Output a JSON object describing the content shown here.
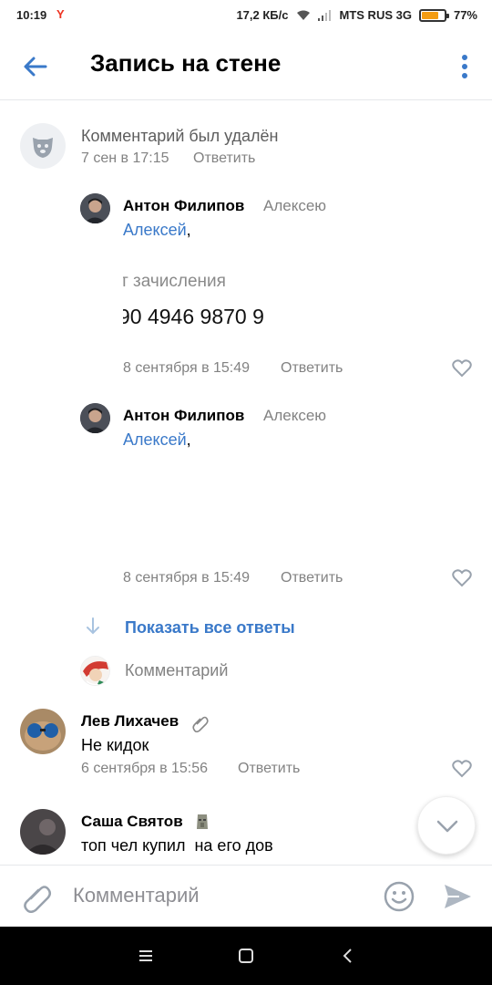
{
  "status_bar": {
    "time": "10:19",
    "app_icon": "Y",
    "network_speed": "17,2 КБ/с",
    "carrier": "MTS RUS 3G",
    "battery": "77%",
    "battery_level": 0.77
  },
  "header": {
    "title": "Запись на стене",
    "back_icon": "arrow-left",
    "more_icon": "vertical-dots"
  },
  "comments": [
    {
      "deleted_text": "Комментарий был удалён",
      "date": "7 сен в 17:15",
      "reply_label": "Ответить"
    }
  ],
  "replies": [
    {
      "author": "Антон Филипов",
      "addressee": "Алексею",
      "mention": "Алексей",
      "mention_suffix": ",",
      "image_text_line1": "т зачисления",
      "image_text_line2": "90 4946 9870 9",
      "date": "8 сентября в 15:49",
      "reply_label": "Ответить"
    },
    {
      "author": "Антон Филипов",
      "addressee": "Алексею",
      "mention": "Алексей",
      "mention_suffix": ",",
      "date": "8 сентября в 15:49",
      "reply_label": "Ответить"
    }
  ],
  "show_all_replies": "Показать все ответы",
  "reply_input_placeholder": "Комментарий",
  "more_comments": [
    {
      "author": "Лев Лихачев",
      "text": "Не кидок",
      "date": "6 сентября в 15:56",
      "reply_label": "Ответить"
    },
    {
      "author": "Саша Святов",
      "text": "топ чел купил  на его дов"
    }
  ],
  "composer": {
    "placeholder": "Комментарий"
  },
  "colors": {
    "accent": "#3a79c9",
    "secondary_text": "#828282",
    "divider": "#e6e7ea"
  }
}
